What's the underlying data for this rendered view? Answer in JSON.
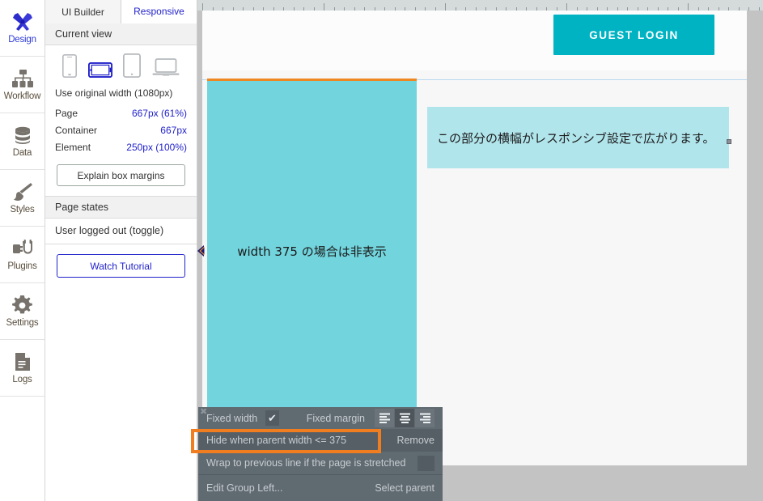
{
  "rail": {
    "items": [
      {
        "label": "Design",
        "icon": "design-tools-icon",
        "active": true
      },
      {
        "label": "Workflow",
        "icon": "workflow-icon",
        "active": false
      },
      {
        "label": "Data",
        "icon": "database-icon",
        "active": false
      },
      {
        "label": "Styles",
        "icon": "paintbrush-icon",
        "active": false
      },
      {
        "label": "Plugins",
        "icon": "plug-icon",
        "active": false
      },
      {
        "label": "Settings",
        "icon": "gear-icon",
        "active": false
      },
      {
        "label": "Logs",
        "icon": "document-icon",
        "active": false
      }
    ]
  },
  "panel": {
    "tabs": [
      {
        "label": "UI Builder",
        "active": false
      },
      {
        "label": "Responsive",
        "active": true
      }
    ],
    "current_view_heading": "Current view",
    "devices": [
      {
        "name": "phone-portrait",
        "selected": false
      },
      {
        "name": "phone-landscape",
        "selected": true
      },
      {
        "name": "tablet",
        "selected": false
      },
      {
        "name": "laptop",
        "selected": false
      }
    ],
    "original_width": "Use original width (1080px)",
    "metrics": [
      {
        "label": "Page",
        "value": "667px (61%)"
      },
      {
        "label": "Container",
        "value": "667px"
      },
      {
        "label": "Element",
        "value": "250px (100%)"
      }
    ],
    "explain_button": "Explain box margins",
    "page_states_heading": "Page states",
    "page_state_toggle": "User logged out (toggle)",
    "watch_tutorial_button": "Watch Tutorial"
  },
  "canvas": {
    "guest_login_label": "GUEST LOGIN",
    "cyan_group_label": "width 375 の場合は非表示",
    "light_cyan_label": "この部分の横幅がレスポンシブ設定で広がります。"
  },
  "context_menu": {
    "fixed_width_label": "Fixed width",
    "fixed_width_checked": true,
    "fixed_margin_label": "Fixed margin",
    "align_options": [
      {
        "name": "align-left",
        "selected": false
      },
      {
        "name": "align-center",
        "selected": true
      },
      {
        "name": "align-right",
        "selected": false
      }
    ],
    "hide_when_label": "Hide when parent width <= 375",
    "remove_label": "Remove",
    "wrap_label": "Wrap to previous line if the page is stretched",
    "wrap_checked": false,
    "edit_group_label": "Edit Group Left...",
    "select_parent_label": "Select parent",
    "close_glyph": "✖"
  },
  "colors": {
    "accent_blue": "#2222cc",
    "teal_button": "#00b3c3",
    "cyan_group": "#72d4dd",
    "light_cyan": "#b1e5ec",
    "selection_orange": "#ee8722",
    "context_menu_bg": "#606a71",
    "canvas_backdrop": "#c3c3c3"
  }
}
